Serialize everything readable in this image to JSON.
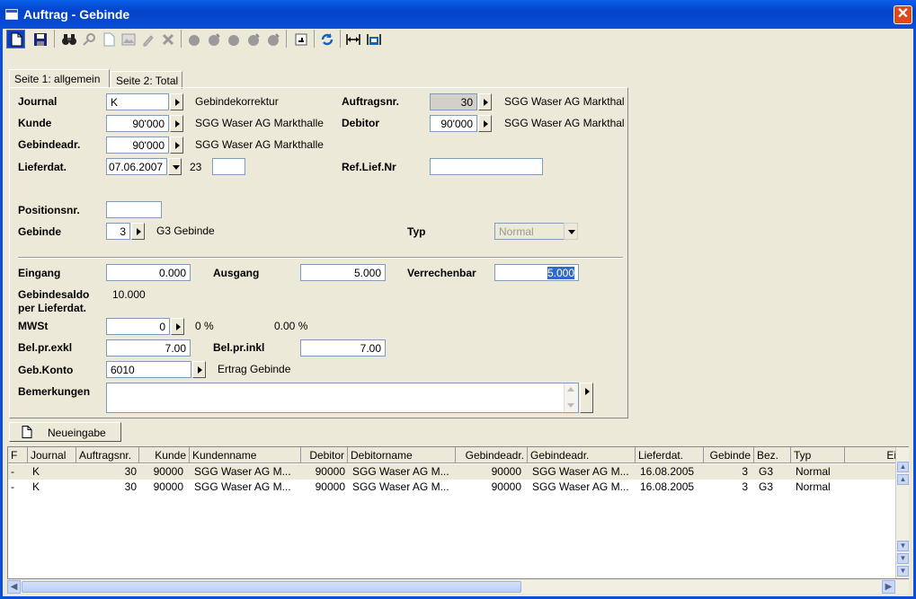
{
  "window": {
    "title": "Auftrag - Gebinde",
    "close_label": "✕"
  },
  "toolbar": {
    "icons": [
      "new-document-icon",
      "save-icon",
      "binoculars-icon",
      "search-icon",
      "blank-page-icon",
      "image-icon",
      "edit-icon",
      "delete-icon",
      "circle-icon-1",
      "circle-icon-2",
      "circle-icon-3",
      "circle-icon-4",
      "circle-icon-5",
      "tab-icon",
      "refresh-icon",
      "expand-icon",
      "fit-icon"
    ]
  },
  "tabs": [
    {
      "label": "Seite 1: allgemein",
      "active": true
    },
    {
      "label": "Seite 2: Total",
      "active": false
    }
  ],
  "form": {
    "journal": {
      "label": "Journal",
      "value": "K",
      "desc": "Gebindekorrektur"
    },
    "auftragsnr": {
      "label": "Auftragsnr.",
      "value": "30",
      "desc": "SGG Waser AG Markthal"
    },
    "kunde": {
      "label": "Kunde",
      "value": "90'000",
      "desc": "SGG Waser AG Markthalle"
    },
    "debitor": {
      "label": "Debitor",
      "value": "90'000",
      "desc": "SGG Waser AG Markthal"
    },
    "gebindeadr": {
      "label": "Gebindeadr.",
      "value": "90'000",
      "desc": "SGG Waser AG Markthalle"
    },
    "lieferdat": {
      "label": "Lieferdat.",
      "value": "07.06.2007",
      "week": "23",
      "extra": ""
    },
    "ref_lief_nr": {
      "label": "Ref.Lief.Nr",
      "value": ""
    },
    "positionsnr": {
      "label": "Positionsnr.",
      "value": ""
    },
    "gebinde": {
      "label": "Gebinde",
      "value": "3",
      "desc": "G3 Gebinde"
    },
    "typ": {
      "label": "Typ",
      "value": "Normal"
    },
    "eingang": {
      "label": "Eingang",
      "value": "0.000"
    },
    "ausgang": {
      "label": "Ausgang",
      "value": "5.000"
    },
    "verrechenbar": {
      "label": "Verrechenbar",
      "value": "5.000"
    },
    "gebindesaldo": {
      "label_line1": "Gebindesaldo",
      "label_line2": "per Lieferdat.",
      "value": "10.000"
    },
    "mwst": {
      "label": "MWSt",
      "value": "0",
      "pct1": "0 %",
      "pct2": "0.00 %"
    },
    "bel_pr_exkl": {
      "label": "Bel.pr.exkl",
      "value": "7.00"
    },
    "bel_pr_inkl": {
      "label": "Bel.pr.inkl",
      "value": "7.00"
    },
    "geb_konto": {
      "label": "Geb.Konto",
      "value": "6010",
      "desc": "Ertrag Gebinde"
    },
    "bemerkungen": {
      "label": "Bemerkungen",
      "value": ""
    }
  },
  "neueingabe_label": "Neueingabe",
  "grid": {
    "columns": [
      "F",
      "Journal",
      "Auftragsnr.",
      "Kunde",
      "Kundenname",
      "Debitor",
      "Debitorname",
      "Gebindeadr.",
      "Gebindeadr.",
      "Lieferdat.",
      "Gebinde",
      "Bez.",
      "Typ",
      "Ei"
    ],
    "rows": [
      [
        "-",
        "K",
        "30",
        "90000",
        "SGG Waser AG M...",
        "90000",
        "SGG Waser AG M...",
        "90000",
        "SGG Waser AG M...",
        "16.08.2005",
        "3",
        "G3",
        "Normal"
      ],
      [
        "-",
        "K",
        "30",
        "90000",
        "SGG Waser AG M...",
        "90000",
        "SGG Waser AG M...",
        "90000",
        "SGG Waser AG M...",
        "16.08.2005",
        "3",
        "G3",
        "Normal"
      ]
    ]
  },
  "colors": {
    "titlebar": "#0342c9",
    "window_bg": "#ece9d8",
    "selection": "#316ac5",
    "close": "#e0481e"
  }
}
